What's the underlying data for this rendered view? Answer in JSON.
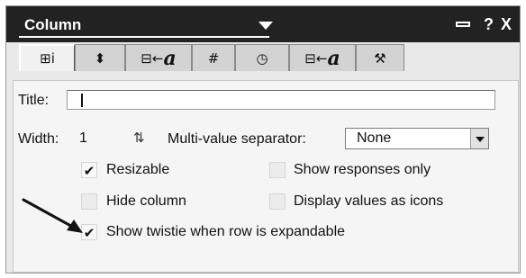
{
  "window": {
    "title": "Column",
    "help_label": "?",
    "close_label": "X"
  },
  "tabs": [
    {
      "name": "tab-column-info",
      "glyph": "⊞ⅰ",
      "active": true
    },
    {
      "name": "tab-sorting",
      "glyph": "⬍",
      "active": false
    },
    {
      "name": "tab-column-font",
      "glyph": "⊟←",
      "letter": "a",
      "active": false
    },
    {
      "name": "tab-number-format",
      "glyph": "#",
      "active": false
    },
    {
      "name": "tab-date-time",
      "glyph": "◷",
      "active": false
    },
    {
      "name": "tab-header-font",
      "glyph": "⊟←",
      "letter": "a",
      "active": false
    },
    {
      "name": "tab-advanced",
      "glyph": "⚒",
      "active": false
    }
  ],
  "form": {
    "title_label": "Title:",
    "title_value": "",
    "width_label": "Width:",
    "width_value": "1",
    "separator_label": "Multi-value separator:",
    "separator_value": "None"
  },
  "options": {
    "resizable": {
      "label": "Resizable",
      "checked": true
    },
    "show_responses_only": {
      "label": "Show responses only",
      "checked": false
    },
    "hide_column": {
      "label": "Hide column",
      "checked": false
    },
    "display_values_as_icons": {
      "label": "Display values as icons",
      "checked": false
    },
    "show_twistie": {
      "label": "Show twistie when row is expandable",
      "checked": true
    }
  },
  "check_glyph": "✔"
}
